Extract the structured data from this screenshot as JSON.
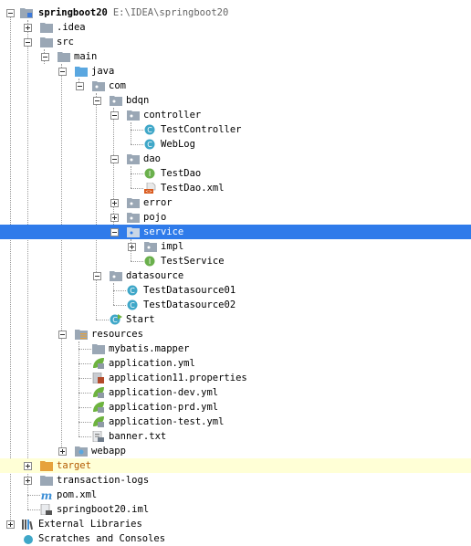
{
  "tree": {
    "root": {
      "label": "springboot20",
      "path": "E:\\IDEA\\springboot20"
    },
    "idea": ".idea",
    "src": "src",
    "main": "main",
    "java": "java",
    "com": "com",
    "bdqn": "bdqn",
    "controller": "controller",
    "test_controller": "TestController",
    "web_log": "WebLog",
    "dao": "dao",
    "test_dao": "TestDao",
    "test_dao_xml": "TestDao.xml",
    "error": "error",
    "pojo": "pojo",
    "service": "service",
    "impl": "impl",
    "test_service": "TestService",
    "datasource": "datasource",
    "test_datasource01": "TestDatasource01",
    "test_datasource02": "TestDatasource02",
    "start": "Start",
    "resources": "resources",
    "mybatis_mapper": "mybatis.mapper",
    "application_yml": "application.yml",
    "application11_properties": "application11.properties",
    "application_dev_yml": "application-dev.yml",
    "application_prd_yml": "application-prd.yml",
    "application_test_yml": "application-test.yml",
    "banner_txt": "banner.txt",
    "webapp": "webapp",
    "target": "target",
    "transaction_logs": "transaction-logs",
    "pom_xml": "pom.xml",
    "springboot20_iml": "springboot20.iml",
    "external_libraries": "External Libraries",
    "scratches": "Scratches and Consoles"
  },
  "colors": {
    "selection": "#2f7bea",
    "target_highlight": "#ffffd6",
    "folder": "#9aa7b5",
    "source_folder": "#5aa7e0",
    "class_icon": "#3fa7c8",
    "interface_icon": "#6ab04c",
    "spring_leaf": "#6db33f",
    "xml_badge": "#d9581b",
    "excluded_folder": "#e6a23c"
  }
}
